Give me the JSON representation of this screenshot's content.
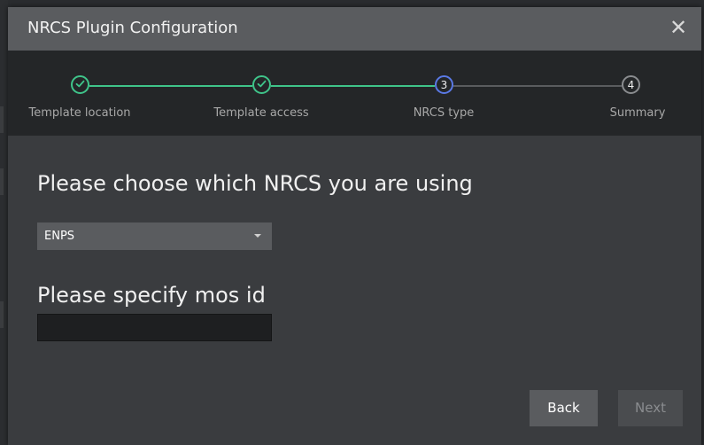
{
  "dialog": {
    "title": "NRCS Plugin Configuration",
    "close_glyph": "✕"
  },
  "stepper": {
    "steps": [
      {
        "label": "Template location",
        "status": "complete",
        "number": ""
      },
      {
        "label": "Template access",
        "status": "complete",
        "number": ""
      },
      {
        "label": "NRCS type",
        "status": "current",
        "number": "3"
      },
      {
        "label": "Summary",
        "status": "pending",
        "number": "4"
      }
    ]
  },
  "form": {
    "nrcs_heading": "Please choose which NRCS you are using",
    "nrcs_selected": "ENPS",
    "mos_heading": "Please specify mos id",
    "mos_value": "",
    "mos_placeholder": ""
  },
  "buttons": {
    "back_label": "Back",
    "next_label": "Next"
  },
  "colors": {
    "complete": "#3fc48a",
    "current": "#5a79e6",
    "pending_line": "#5a5c5f",
    "pending_circle": "#8a8c8f"
  },
  "icons": {
    "close": "close-icon",
    "check": "check-icon",
    "dropdown": "chevron-down-icon"
  }
}
